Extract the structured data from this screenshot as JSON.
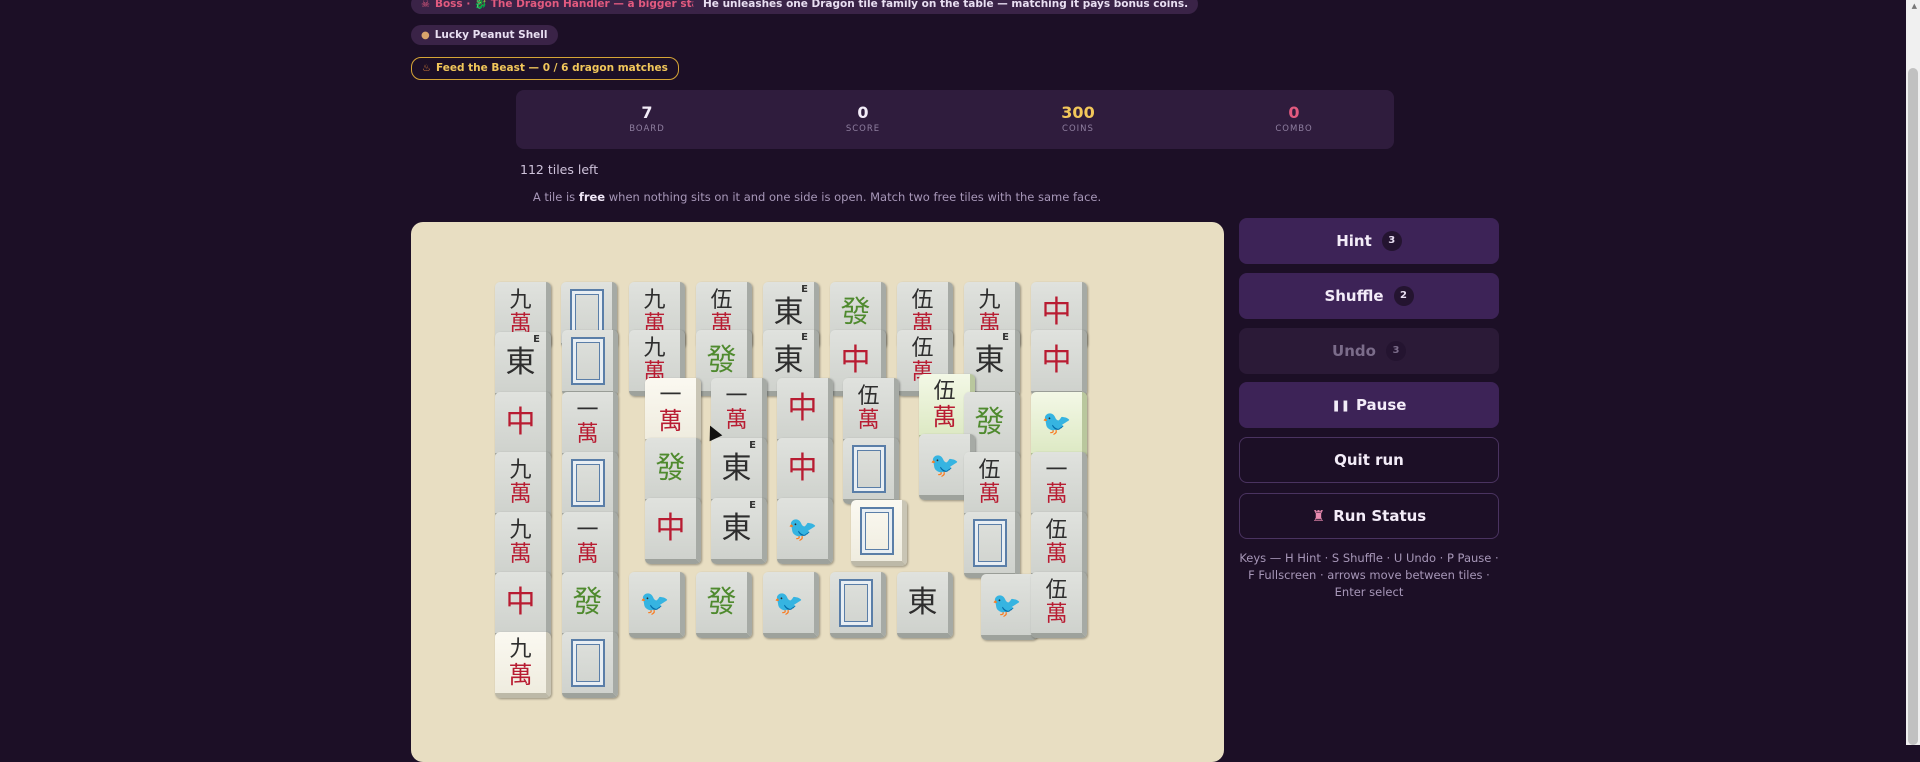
{
  "header": {
    "boss_icon": "skull-icon",
    "boss_text": "Boss · 🐉 The Dragon Handler — a bigger stack",
    "boss_desc": "He unleashes one Dragon tile family on the table — matching it pays bonus coins.",
    "charm_icon": "peanut-icon",
    "charm_text": "Lucky Peanut Shell",
    "quest_icon": "flame-icon",
    "quest_text": "Feed the Beast — 0 / 6 dragon matches"
  },
  "stats": {
    "board": {
      "value": "7",
      "label": "BOARD"
    },
    "score": {
      "value": "0",
      "label": "SCORE"
    },
    "coins": {
      "value": "300",
      "label": "COINS"
    },
    "combo": {
      "value": "0",
      "label": "COMBO"
    }
  },
  "tiles_left": "112 tiles left",
  "tip": {
    "pre": "A tile is ",
    "bold": "free",
    "post": " when nothing sits on it and one side is open. Match two free tiles with the same face."
  },
  "buttons": {
    "hint": {
      "label": "Hint",
      "count": "3"
    },
    "shuffle": {
      "label": "Shuffle",
      "count": "2"
    },
    "undo": {
      "label": "Undo",
      "count": "3"
    },
    "pause": {
      "label": "Pause",
      "icon": "pause-icon"
    },
    "quit": {
      "label": "Quit run"
    },
    "status": {
      "label": "Run Status",
      "icon": "castle-icon"
    }
  },
  "keys_help": "Keys — H Hint · S Shuffle · U Undo · P Pause · F Fullscreen · arrows move between tiles · Enter select",
  "colors": {
    "background": "#1c0f26",
    "panel": "#2f1c3d",
    "button": "#3d2357",
    "coins": "#f2c75a",
    "combo": "#e25a7f",
    "board": "#e8dec2"
  },
  "tiles": [
    {
      "face": "九萬",
      "top": "九",
      "bot": "萬"
    },
    {
      "face": "white-dragon"
    },
    {
      "face": "九萬",
      "top": "九",
      "bot": "萬"
    },
    {
      "face": "伍萬",
      "top": "伍",
      "bot": "萬"
    },
    {
      "face": "東",
      "glyph": "東",
      "wind": "E"
    },
    {
      "face": "發",
      "glyph": "發"
    },
    {
      "face": "伍萬",
      "top": "伍",
      "bot": "萬"
    },
    {
      "face": "九萬",
      "top": "九",
      "bot": "萬"
    },
    {
      "face": "中",
      "glyph": "中"
    },
    {
      "face": "東",
      "glyph": "東",
      "wind": "E"
    },
    {
      "face": "white-dragon"
    },
    {
      "face": "九萬",
      "top": "九",
      "bot": "萬"
    },
    {
      "face": "發",
      "glyph": "發"
    },
    {
      "face": "東",
      "glyph": "東",
      "wind": "E"
    },
    {
      "face": "中",
      "glyph": "中"
    },
    {
      "face": "伍萬",
      "top": "伍",
      "bot": "萬"
    },
    {
      "face": "東",
      "glyph": "東",
      "wind": "E"
    },
    {
      "face": "中",
      "glyph": "中"
    },
    {
      "face": "中",
      "glyph": "中"
    },
    {
      "face": "一萬",
      "top": "一",
      "bot": "萬"
    },
    {
      "face": "一萬",
      "top": "一",
      "bot": "萬"
    },
    {
      "face": "一萬",
      "top": "一",
      "bot": "萬"
    },
    {
      "face": "中",
      "glyph": "中"
    },
    {
      "face": "伍萬",
      "top": "伍",
      "bot": "萬"
    },
    {
      "face": "伍萬",
      "top": "伍",
      "bot": "萬"
    },
    {
      "face": "發",
      "glyph": "發"
    },
    {
      "face": "bird"
    },
    {
      "face": "九萬",
      "top": "九",
      "bot": "萬"
    },
    {
      "face": "white-dragon"
    },
    {
      "face": "發",
      "glyph": "發"
    },
    {
      "face": "東",
      "glyph": "東",
      "wind": "E"
    },
    {
      "face": "中",
      "glyph": "中"
    },
    {
      "face": "white-dragon"
    },
    {
      "face": "bird"
    },
    {
      "face": "伍萬",
      "top": "伍",
      "bot": "萬"
    },
    {
      "face": "一萬",
      "top": "一",
      "bot": "萬"
    },
    {
      "face": "九萬",
      "top": "九",
      "bot": "萬"
    },
    {
      "face": "一萬",
      "top": "一",
      "bot": "萬"
    },
    {
      "face": "中",
      "glyph": "中"
    },
    {
      "face": "東",
      "glyph": "東",
      "wind": "E"
    },
    {
      "face": "bird"
    },
    {
      "face": "white-dragon"
    },
    {
      "face": "white-dragon"
    },
    {
      "face": "伍萬",
      "top": "伍",
      "bot": "萬"
    },
    {
      "face": "中",
      "glyph": "中"
    },
    {
      "face": "發",
      "glyph": "發"
    },
    {
      "face": "bird"
    },
    {
      "face": "發",
      "glyph": "發"
    },
    {
      "face": "bird"
    },
    {
      "face": "white-dragon"
    },
    {
      "face": "東",
      "glyph": "東"
    },
    {
      "face": "bird"
    },
    {
      "face": "伍萬",
      "top": "伍",
      "bot": "萬"
    },
    {
      "face": "九萬",
      "top": "九",
      "bot": "萬"
    },
    {
      "face": "white-dragon"
    }
  ]
}
